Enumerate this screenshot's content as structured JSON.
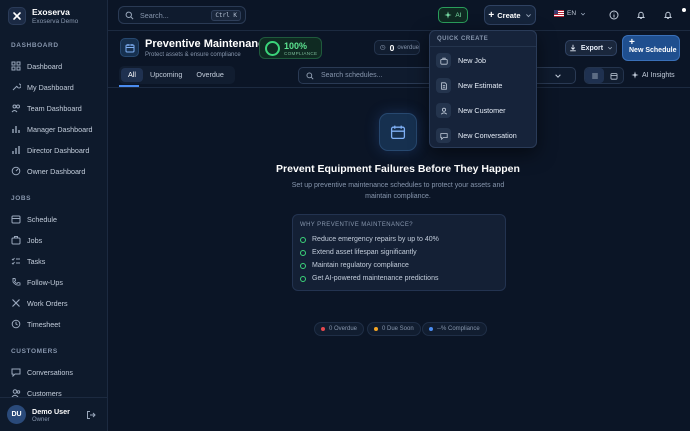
{
  "brand": {
    "name": "Exoserva",
    "subtitle": "Exoserva Demo"
  },
  "sidebar": {
    "sections": [
      {
        "label": "DASHBOARD"
      },
      {
        "label": "JOBS"
      },
      {
        "label": "CUSTOMERS"
      }
    ],
    "items": [
      {
        "label": "Dashboard",
        "icon": "grid-icon"
      },
      {
        "label": "My Dashboard",
        "icon": "wrench-icon"
      },
      {
        "label": "Team Dashboard",
        "icon": "team-icon"
      },
      {
        "label": "Manager Dashboard",
        "icon": "bar-chart-icon"
      },
      {
        "label": "Director Dashboard",
        "icon": "bar-chart-icon"
      },
      {
        "label": "Owner Dashboard",
        "icon": "gauge-icon"
      },
      {
        "label": "Schedule",
        "icon": "calendar-icon"
      },
      {
        "label": "Jobs",
        "icon": "briefcase-icon"
      },
      {
        "label": "Tasks",
        "icon": "checklist-icon"
      },
      {
        "label": "Follow-Ups",
        "icon": "phone-icon"
      },
      {
        "label": "Work Orders",
        "icon": "tools-icon"
      },
      {
        "label": "Timesheet",
        "icon": "clock-icon"
      },
      {
        "label": "Conversations",
        "icon": "chat-icon"
      },
      {
        "label": "Customers",
        "icon": "users-icon"
      }
    ]
  },
  "user": {
    "initials": "DU",
    "name": "Demo User",
    "role": "Owner"
  },
  "topbar": {
    "search_placeholder": "Search...",
    "shortcut": "Ctrl K",
    "ai_label": "AI",
    "create_label": "Create",
    "language": "EN"
  },
  "page": {
    "title": "Preventive Maintenance",
    "subtitle": "Protect assets & ensure compliance",
    "compliance_value": "100%",
    "compliance_label": "COMPLIANCE",
    "overdue_count": "0",
    "overdue_label": "overdue",
    "export_label": "Export",
    "new_schedule_label": "New Schedule"
  },
  "tabs": [
    {
      "label": "All",
      "active": true
    },
    {
      "label": "Upcoming",
      "active": false
    },
    {
      "label": "Overdue",
      "active": false
    }
  ],
  "toolbar": {
    "search_placeholder": "Search schedules...",
    "ai_insights_label": "AI Insights"
  },
  "quick_create": {
    "heading": "QUICK CREATE",
    "items": [
      {
        "label": "New Job",
        "icon": "briefcase-icon"
      },
      {
        "label": "New Estimate",
        "icon": "document-icon"
      },
      {
        "label": "New Customer",
        "icon": "user-icon"
      },
      {
        "label": "New Conversation",
        "icon": "chat-icon"
      }
    ]
  },
  "empty_state": {
    "title": "Prevent Equipment Failures Before They Happen",
    "description": "Set up preventive maintenance schedules to protect your assets and maintain compliance.",
    "why_heading": "WHY PREVENTIVE MAINTENANCE?",
    "reasons": [
      "Reduce emergency repairs by up to 40%",
      "Extend asset lifespan significantly",
      "Maintain regulatory compliance",
      "Get AI-powered maintenance predictions"
    ]
  },
  "stats": [
    {
      "label": "0 Overdue",
      "color": "#e5484d"
    },
    {
      "label": "0 Due Soon",
      "color": "#f5a524"
    },
    {
      "label": "--% Compliance",
      "color": "#4b8cf0"
    }
  ],
  "colors": {
    "accent": "#4b8cf0",
    "success": "#3bd47a",
    "background": "#0b1526"
  }
}
